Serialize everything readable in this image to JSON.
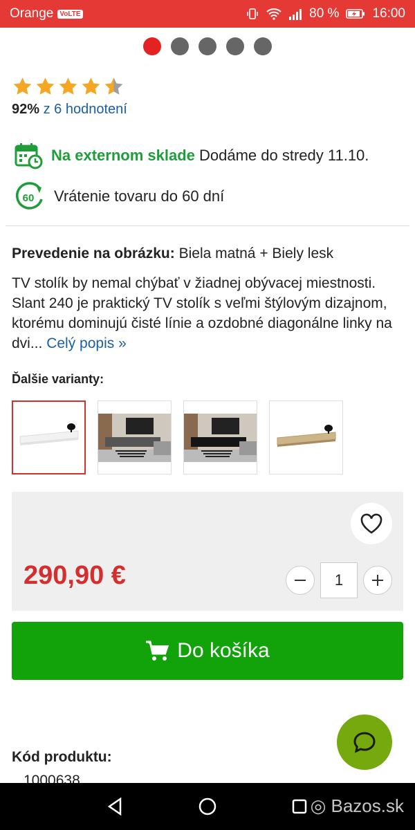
{
  "status_bar": {
    "carrier": "Orange",
    "volte": "VoLTE",
    "battery": "80 %",
    "time": "16:00"
  },
  "carousel": {
    "dot_count": 5,
    "active_index": 0
  },
  "rating": {
    "stars": 4.5,
    "percent": "92%",
    "count_text": "z 6 hodnotení"
  },
  "stock": {
    "status": "Na externom sklade",
    "delivery": "Dodáme do stredy 11.10."
  },
  "returns": {
    "badge": "60",
    "text": "Vrátenie tovaru do 60 dní"
  },
  "product": {
    "variant_label": "Prevedenie na obrázku:",
    "variant_value": "Biela matná + Biely lesk",
    "description": "TV stolík by nemal chýbať v žiadnej obývacej miestnosti. Slant 240 je praktický TV stolík s veľmi štýlovým dizajnom, ktorému dominujú čisté línie a ozdobné diagonálne linky na dvi...",
    "more_link": "Celý popis »",
    "variants_title": "Ďalšie varianty:",
    "price": "290,90 €",
    "quantity": "1",
    "add_to_cart": "Do košíka",
    "code_label": "Kód produktu:",
    "code_value": "1000638"
  },
  "watermark": "Bazos.sk",
  "colors": {
    "brand_red": "#e53935",
    "price_red": "#d32f2f",
    "cart_green": "#12a20a",
    "stock_green": "#1f9d3a",
    "chat_green": "#76a90d",
    "link_blue": "#1a5fa8"
  }
}
